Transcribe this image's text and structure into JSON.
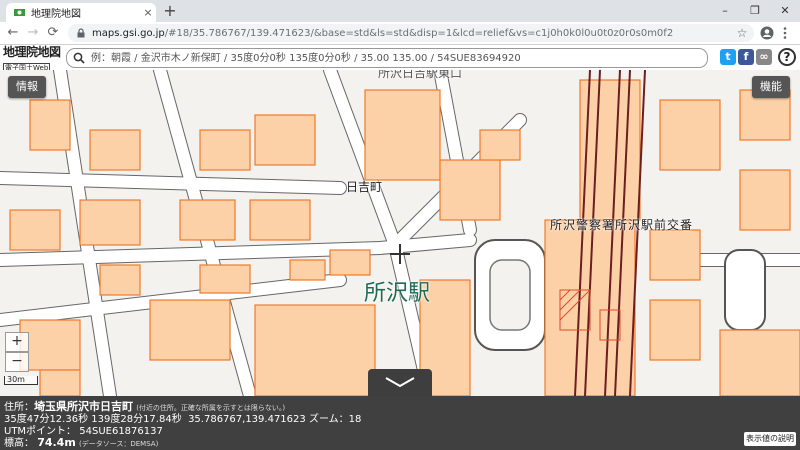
{
  "browser": {
    "tab_title": "地理院地図",
    "tab_close": "×",
    "new_tab": "+",
    "url_host": "maps.gsi.go.jp",
    "url_rest": "/#18/35.786767/139.471623/&base=std&ls=std&disp=1&lcd=relief&vs=c1j0h0k0l0u0t0z0r0s0m0f2",
    "back": "←",
    "forward": "→",
    "reload": "⟳",
    "minimize": "–",
    "restore": "❐",
    "close": "✕",
    "star": "☆"
  },
  "site": {
    "logo_main": "地理院地図",
    "logo_sub": "電子国土Web",
    "search_placeholder": "例：朝霞 / 金沢市木ノ新保町 / 35度0分0秒 135度0分0秒 / 35.00 135.00 / 54SUE83694920",
    "share_twitter": "t",
    "share_facebook": "f",
    "share_link": "∞",
    "help": "?"
  },
  "map": {
    "info_button": "情報",
    "function_button": "機能",
    "zoom_in": "+",
    "zoom_out": "−",
    "scale": "30m",
    "labels": {
      "station": "所沢駅",
      "town": "日吉町",
      "police": "所沢警察署所沢駅前交番",
      "top_cut": "所沢日吉駅東口"
    },
    "colors": {
      "building": "#fdd1a8",
      "building_edge": "#f07a2b",
      "road_edge": "#555555",
      "rail": "#6b1f1f"
    }
  },
  "info": {
    "address_label": "住所：",
    "address": "埼玉県所沢市日吉町",
    "address_note": "(付近の住所。正確な所属を示すとは限らない。)",
    "coords": "35度47分12.36秒 139度28分17.84秒",
    "decimal": "35.786767,139.471623",
    "zoom_label": "ズーム：",
    "zoom": "18",
    "utm_label": "UTMポイント：",
    "utm": "54SUE61876137",
    "elev_label": "標高：",
    "elev": "74.4m",
    "elev_source": "(データソース：DEMSA)",
    "legend_button": "表示値の説明"
  }
}
